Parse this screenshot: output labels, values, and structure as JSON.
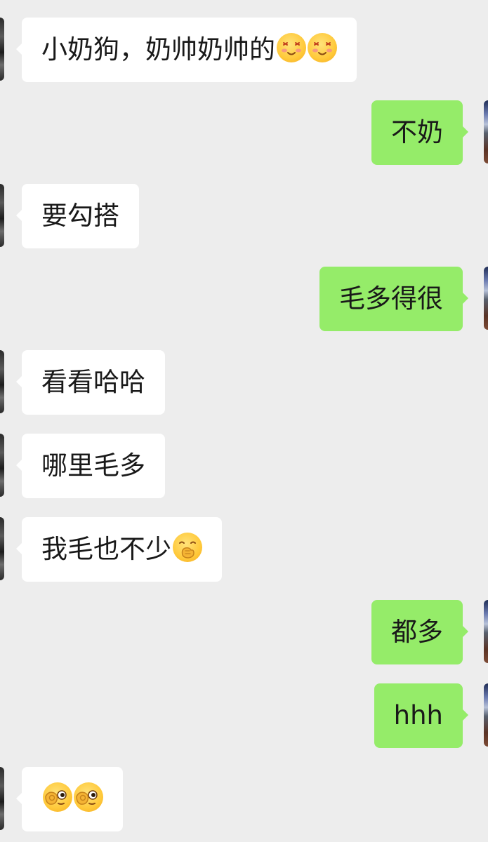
{
  "conversation": {
    "messages": [
      {
        "side": "left",
        "text": "小奶狗，奶帅奶帅的",
        "emojis": [
          "blushing-smile-emoji",
          "blushing-smile-emoji"
        ]
      },
      {
        "side": "right",
        "text": "不奶",
        "emojis": []
      },
      {
        "side": "left",
        "text": "要勾搭",
        "emojis": []
      },
      {
        "side": "right",
        "text": "毛多得很",
        "emojis": []
      },
      {
        "side": "left",
        "text": "看看哈哈",
        "emojis": []
      },
      {
        "side": "left",
        "text": "哪里毛多",
        "emojis": []
      },
      {
        "side": "left",
        "text": "我毛也不少",
        "emojis": [
          "hand-over-mouth-emoji"
        ]
      },
      {
        "side": "right",
        "text": "都多",
        "emojis": []
      },
      {
        "side": "right",
        "text": "hhh",
        "emojis": []
      },
      {
        "side": "left",
        "text": "",
        "emojis": [
          "ok-eye-emoji",
          "ok-eye-emoji"
        ]
      }
    ]
  },
  "colors": {
    "background": "#ededed",
    "incoming_bubble": "#ffffff",
    "outgoing_bubble": "#95ec69",
    "text": "#191919"
  }
}
